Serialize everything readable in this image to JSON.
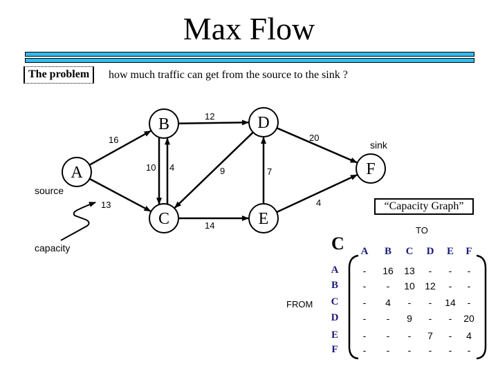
{
  "slide": {
    "title": "Max Flow",
    "problem_label": "The problem",
    "problem_text": "how much traffic can get from the source to the sink ?",
    "accent_bar_color": "#33bbee"
  },
  "graph": {
    "source_label": "source",
    "sink_label": "sink",
    "capacity_label": "capacity",
    "nodes": [
      "A",
      "B",
      "C",
      "D",
      "E",
      "F"
    ],
    "edges": [
      {
        "from": "A",
        "to": "B",
        "capacity": "16"
      },
      {
        "from": "A",
        "to": "C",
        "capacity": "13"
      },
      {
        "from": "B",
        "to": "C",
        "capacity": "10"
      },
      {
        "from": "C",
        "to": "B",
        "capacity": "4"
      },
      {
        "from": "B",
        "to": "D",
        "capacity": "12"
      },
      {
        "from": "D",
        "to": "C",
        "capacity": "9"
      },
      {
        "from": "C",
        "to": "E",
        "capacity": "14"
      },
      {
        "from": "E",
        "to": "D",
        "capacity": "7"
      },
      {
        "from": "D",
        "to": "F",
        "capacity": "20"
      },
      {
        "from": "E",
        "to": "F",
        "capacity": "4"
      }
    ]
  },
  "matrix": {
    "caption": "“Capacity Graph”",
    "name": "C",
    "to_label": "TO",
    "from_label": "FROM",
    "header_color": "#1a1a7a",
    "columns": [
      "A",
      "B",
      "C",
      "D",
      "E",
      "F"
    ],
    "rows": [
      {
        "label": "A",
        "values": [
          "-",
          "16",
          "13",
          "-",
          "-",
          "-"
        ]
      },
      {
        "label": "B",
        "values": [
          "-",
          "-",
          "10",
          "12",
          "-",
          "-"
        ]
      },
      {
        "label": "C",
        "values": [
          "-",
          "4",
          "-",
          "-",
          "14",
          "-"
        ]
      },
      {
        "label": "D",
        "values": [
          "-",
          "-",
          "9",
          "-",
          "-",
          "20"
        ]
      },
      {
        "label": "E",
        "values": [
          "-",
          "-",
          "-",
          "7",
          "-",
          "4"
        ]
      },
      {
        "label": "F",
        "values": [
          "-",
          "-",
          "-",
          "-",
          "-",
          "-"
        ]
      }
    ]
  }
}
